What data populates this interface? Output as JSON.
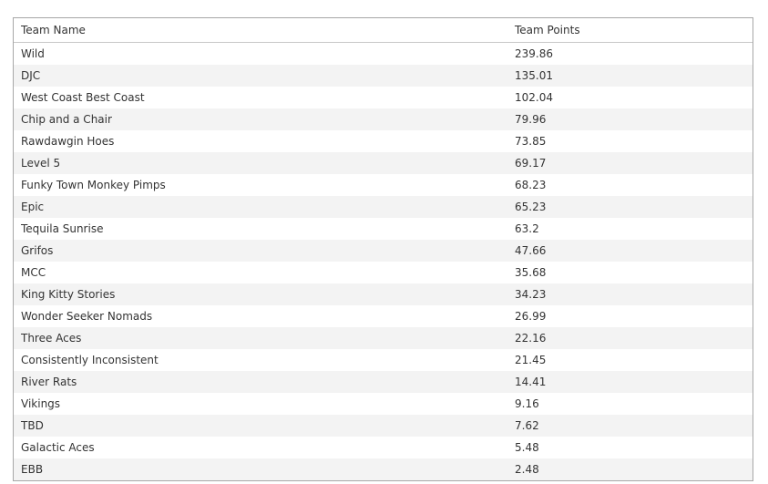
{
  "table": {
    "headers": {
      "team_name": "Team Name",
      "team_points": "Team Points"
    },
    "rows": [
      {
        "team_name": "Wild",
        "team_points": "239.86"
      },
      {
        "team_name": "DJC",
        "team_points": "135.01"
      },
      {
        "team_name": "West Coast Best Coast",
        "team_points": "102.04"
      },
      {
        "team_name": "Chip and a Chair",
        "team_points": "79.96"
      },
      {
        "team_name": "Rawdawgin Hoes",
        "team_points": "73.85"
      },
      {
        "team_name": "Level 5",
        "team_points": "69.17"
      },
      {
        "team_name": "Funky Town Monkey Pimps",
        "team_points": "68.23"
      },
      {
        "team_name": "Epic",
        "team_points": "65.23"
      },
      {
        "team_name": "Tequila Sunrise",
        "team_points": "63.2"
      },
      {
        "team_name": "Grifos",
        "team_points": "47.66"
      },
      {
        "team_name": "MCC",
        "team_points": "35.68"
      },
      {
        "team_name": "King Kitty Stories",
        "team_points": "34.23"
      },
      {
        "team_name": "Wonder Seeker Nomads",
        "team_points": "26.99"
      },
      {
        "team_name": "Three Aces",
        "team_points": "22.16"
      },
      {
        "team_name": "Consistently Inconsistent",
        "team_points": "21.45"
      },
      {
        "team_name": "River Rats",
        "team_points": "14.41"
      },
      {
        "team_name": "Vikings",
        "team_points": "9.16"
      },
      {
        "team_name": "TBD",
        "team_points": "7.62"
      },
      {
        "team_name": "Galactic Aces",
        "team_points": "5.48"
      },
      {
        "team_name": "EBB",
        "team_points": "2.48"
      }
    ]
  }
}
